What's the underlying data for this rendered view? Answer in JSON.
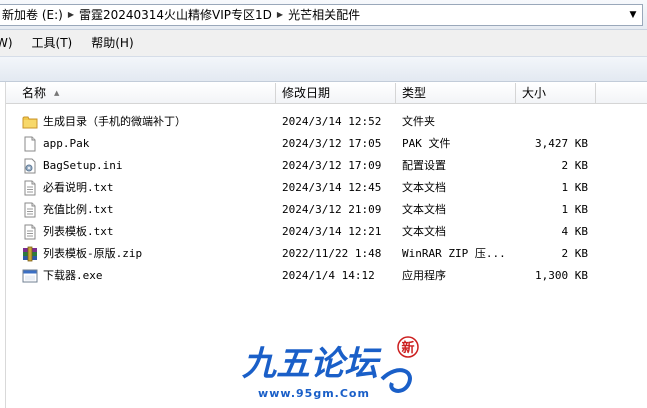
{
  "address_bar": {
    "crumbs": [
      "新加卷 (E:)",
      "雷霆20240314火山精修VIP专区1D",
      "光芒相关配件"
    ],
    "dropdown_icon": "chevron-down-icon"
  },
  "menu": {
    "items": [
      "W)",
      "工具(T)",
      "帮助(H)"
    ]
  },
  "columns": {
    "name": "名称",
    "date": "修改日期",
    "type": "类型",
    "size": "大小"
  },
  "files": [
    {
      "name": "生成目录（手机的微端补丁）",
      "date": "2024/3/14 12:52",
      "type": "文件夹",
      "size": "",
      "icon": "folder-icon"
    },
    {
      "name": "app.Pak",
      "date": "2024/3/12 17:05",
      "type": "PAK 文件",
      "size": "3,427 KB",
      "icon": "file-icon"
    },
    {
      "name": "BagSetup.ini",
      "date": "2024/3/12 17:09",
      "type": "配置设置",
      "size": "2 KB",
      "icon": "settings-file-icon"
    },
    {
      "name": "必看说明.txt",
      "date": "2024/3/14 12:45",
      "type": "文本文档",
      "size": "1 KB",
      "icon": "text-file-icon"
    },
    {
      "name": "充值比例.txt",
      "date": "2024/3/12 21:09",
      "type": "文本文档",
      "size": "1 KB",
      "icon": "text-file-icon"
    },
    {
      "name": "列表模板.txt",
      "date": "2024/3/14 12:21",
      "type": "文本文档",
      "size": "4 KB",
      "icon": "text-file-icon"
    },
    {
      "name": "列表模板-原版.zip",
      "date": "2022/11/22 1:48",
      "type": "WinRAR ZIP 压...",
      "size": "2 KB",
      "icon": "zip-archive-icon"
    },
    {
      "name": "下载器.exe",
      "date": "2024/1/4 14:12",
      "type": "应用程序",
      "size": "1,300 KB",
      "icon": "application-icon"
    }
  ],
  "watermark": {
    "title": "九五论坛",
    "badge": "新",
    "url": "www.95gm.Com",
    "colors": {
      "blue": "#1a5fc8",
      "red": "#cc1f1f"
    }
  },
  "colors": {
    "folder": "#f2c94c",
    "header_border": "#d5d5d5"
  }
}
